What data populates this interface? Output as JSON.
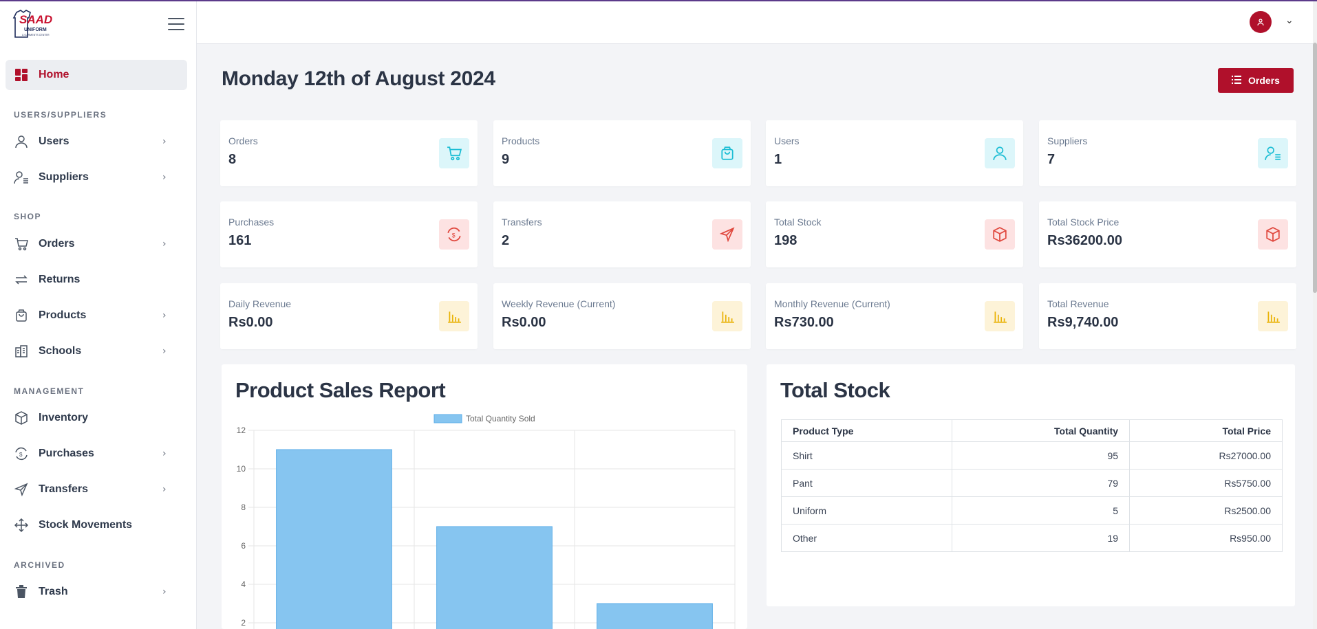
{
  "sidebar": {
    "logo_text": "SAAD",
    "logo_sub": "UNIFORM",
    "logo_sub2": "& GARMENTS CENTER",
    "home": "Home",
    "sections": {
      "users": "USERS/SUPPLIERS",
      "shop": "SHOP",
      "management": "MANAGEMENT",
      "archived": "ARCHIVED"
    },
    "items": {
      "users": "Users",
      "suppliers": "Suppliers",
      "orders": "Orders",
      "returns": "Returns",
      "products": "Products",
      "schools": "Schools",
      "inventory": "Inventory",
      "purchases": "Purchases",
      "transfers": "Transfers",
      "stock_movements": "Stock Movements",
      "trash": "Trash"
    }
  },
  "page": {
    "date_title": "Monday 12th of August 2024",
    "orders_button": "Orders"
  },
  "stats": {
    "orders": {
      "label": "Orders",
      "value": "8"
    },
    "products": {
      "label": "Products",
      "value": "9"
    },
    "users": {
      "label": "Users",
      "value": "1"
    },
    "suppliers": {
      "label": "Suppliers",
      "value": "7"
    },
    "purchases": {
      "label": "Purchases",
      "value": "161"
    },
    "transfers": {
      "label": "Transfers",
      "value": "2"
    },
    "total_stock": {
      "label": "Total Stock",
      "value": "198"
    },
    "total_stock_price": {
      "label": "Total Stock Price",
      "value": "Rs36200.00"
    },
    "daily_revenue": {
      "label": "Daily Revenue",
      "value": "Rs0.00"
    },
    "weekly_revenue": {
      "label": "Weekly Revenue (Current)",
      "value": "Rs0.00"
    },
    "monthly_revenue": {
      "label": "Monthly Revenue (Current)",
      "value": "Rs730.00"
    },
    "total_revenue": {
      "label": "Total Revenue",
      "value": "Rs9,740.00"
    }
  },
  "sales_report": {
    "title": "Product Sales Report"
  },
  "chart_data": {
    "type": "bar",
    "title": "",
    "xlabel": "",
    "ylabel": "",
    "categories": [
      "",
      "",
      ""
    ],
    "series": [
      {
        "name": "Total Quantity Sold",
        "values": [
          11,
          7,
          3
        ]
      }
    ],
    "ylim": [
      0,
      12
    ],
    "yticks": [
      "2",
      "4",
      "6",
      "8",
      "10",
      "12"
    ],
    "grid": true,
    "legend": "top",
    "bar_color": "#86c5f0",
    "bar_border": "#5eaee8"
  },
  "total_stock": {
    "title": "Total Stock",
    "columns": [
      "Product Type",
      "Total Quantity",
      "Total Price"
    ],
    "rows": [
      [
        "Shirt",
        "95",
        "Rs27000.00"
      ],
      [
        "Pant",
        "79",
        "Rs5750.00"
      ],
      [
        "Uniform",
        "5",
        "Rs2500.00"
      ],
      [
        "Other",
        "19",
        "Rs950.00"
      ]
    ]
  },
  "colors": {
    "brand": "#b0102b",
    "teal_icon": "#1bbdd4",
    "red_icon": "#e0483e",
    "yellow_icon": "#eab308"
  }
}
